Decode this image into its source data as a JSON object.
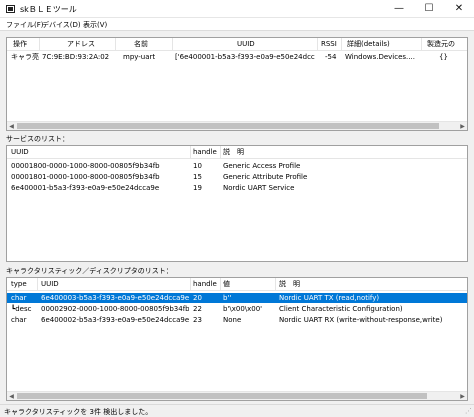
{
  "window": {
    "title": "skＢＬＥツール",
    "min_glyph": "—",
    "max_glyph": "☐",
    "close_glyph": "✕"
  },
  "menu": [
    "ファイル(F)",
    "デバイス(D)",
    "表示(V)"
  ],
  "devices": {
    "columns": [
      "操作",
      "アドレス",
      "名前",
      "UUID",
      "RSSI",
      "詳細(details)",
      "製造元の"
    ],
    "rows": [
      [
        "キャラ亮",
        "7C:9E:BD:93:2A:02",
        "mpy-uart",
        "['6e400001-b5a3-f393-e0a9-e50e24dcca9e']",
        "-54",
        "Windows.Devices....",
        "{}"
      ]
    ]
  },
  "services": {
    "label": "サービスのリスト：",
    "columns": [
      "UUID",
      "handle",
      "説　明"
    ],
    "rows": [
      [
        "00001800-0000-1000-8000-00805f9b34fb",
        "10",
        "Generic Access Profile"
      ],
      [
        "00001801-0000-1000-8000-00805f9b34fb",
        "15",
        "Generic Attribute Profile"
      ],
      [
        "6e400001-b5a3-f393-e0a9-e50e24dcca9e",
        "19",
        "Nordic UART Service"
      ]
    ]
  },
  "characteristics": {
    "label": "キャラクタリスティック／ディスクリプタのリスト：",
    "columns": [
      "type",
      "UUID",
      "handle",
      "値",
      "説　明"
    ],
    "rows": [
      [
        "char",
        "6e400003-b5a3-f393-e0a9-e50e24dcca9e",
        "20",
        "b''",
        "Nordic UART TX (read,notify)"
      ],
      [
        "┗desc",
        "00002902-0000-1000-8000-00805f9b34fb",
        "22",
        "b'\\x00\\x00'",
        "Client Characteristic Configuration)"
      ],
      [
        "char",
        "6e400002-b5a3-f393-e0a9-e50e24dcca9e",
        "23",
        "None",
        "Nordic UART RX (write-without-response,write)"
      ]
    ],
    "selected_row": 0
  },
  "status": {
    "text": "キャラクタリスティックを 3件 検出しました。"
  },
  "scroll_glyphs": {
    "left": "◀",
    "right": "▶"
  },
  "grip_glyph": "⋰"
}
